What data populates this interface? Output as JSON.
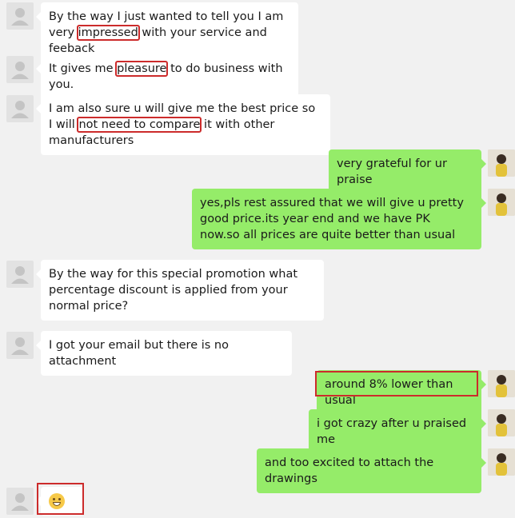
{
  "messages": [
    {
      "dir": "in",
      "parts": [
        {
          "t": "By the way I just wanted to tell you I am very "
        },
        {
          "t": "impressed",
          "hl": true
        },
        {
          "t": " with your service and feeback"
        }
      ]
    },
    {
      "dir": "in",
      "parts": [
        {
          "t": "It gives me "
        },
        {
          "t": "pleasure",
          "hl": true
        },
        {
          "t": " to do business with you."
        }
      ]
    },
    {
      "dir": "in",
      "parts": [
        {
          "t": "I am also sure u will give me the best price so I will "
        },
        {
          "t": "not need to compare",
          "hl": true
        },
        {
          "t": " it with other manufacturers"
        }
      ]
    },
    {
      "dir": "out",
      "parts": [
        {
          "t": "very grateful for ur praise"
        }
      ]
    },
    {
      "dir": "out",
      "parts": [
        {
          "t": "yes,pls rest assured that we will give u pretty good price.its year end and we have PK now.so all prices are quite better than usual"
        }
      ]
    },
    {
      "dir": "in",
      "parts": [
        {
          "t": "By the way for this special promotion what percentage discount is applied from your normal price?"
        }
      ]
    },
    {
      "dir": "in",
      "parts": [
        {
          "t": "I got your email but there is no attachment"
        }
      ]
    },
    {
      "dir": "out",
      "parts": [
        {
          "t": "around 8% lower than usual"
        }
      ],
      "box": true
    },
    {
      "dir": "out",
      "parts": [
        {
          "t": "i got crazy after u praised me"
        }
      ]
    },
    {
      "dir": "out",
      "parts": [
        {
          "t": "and too excited to attach the drawings"
        }
      ]
    },
    {
      "dir": "in",
      "parts": [],
      "emoji": "grinning-face",
      "box": true
    }
  ]
}
